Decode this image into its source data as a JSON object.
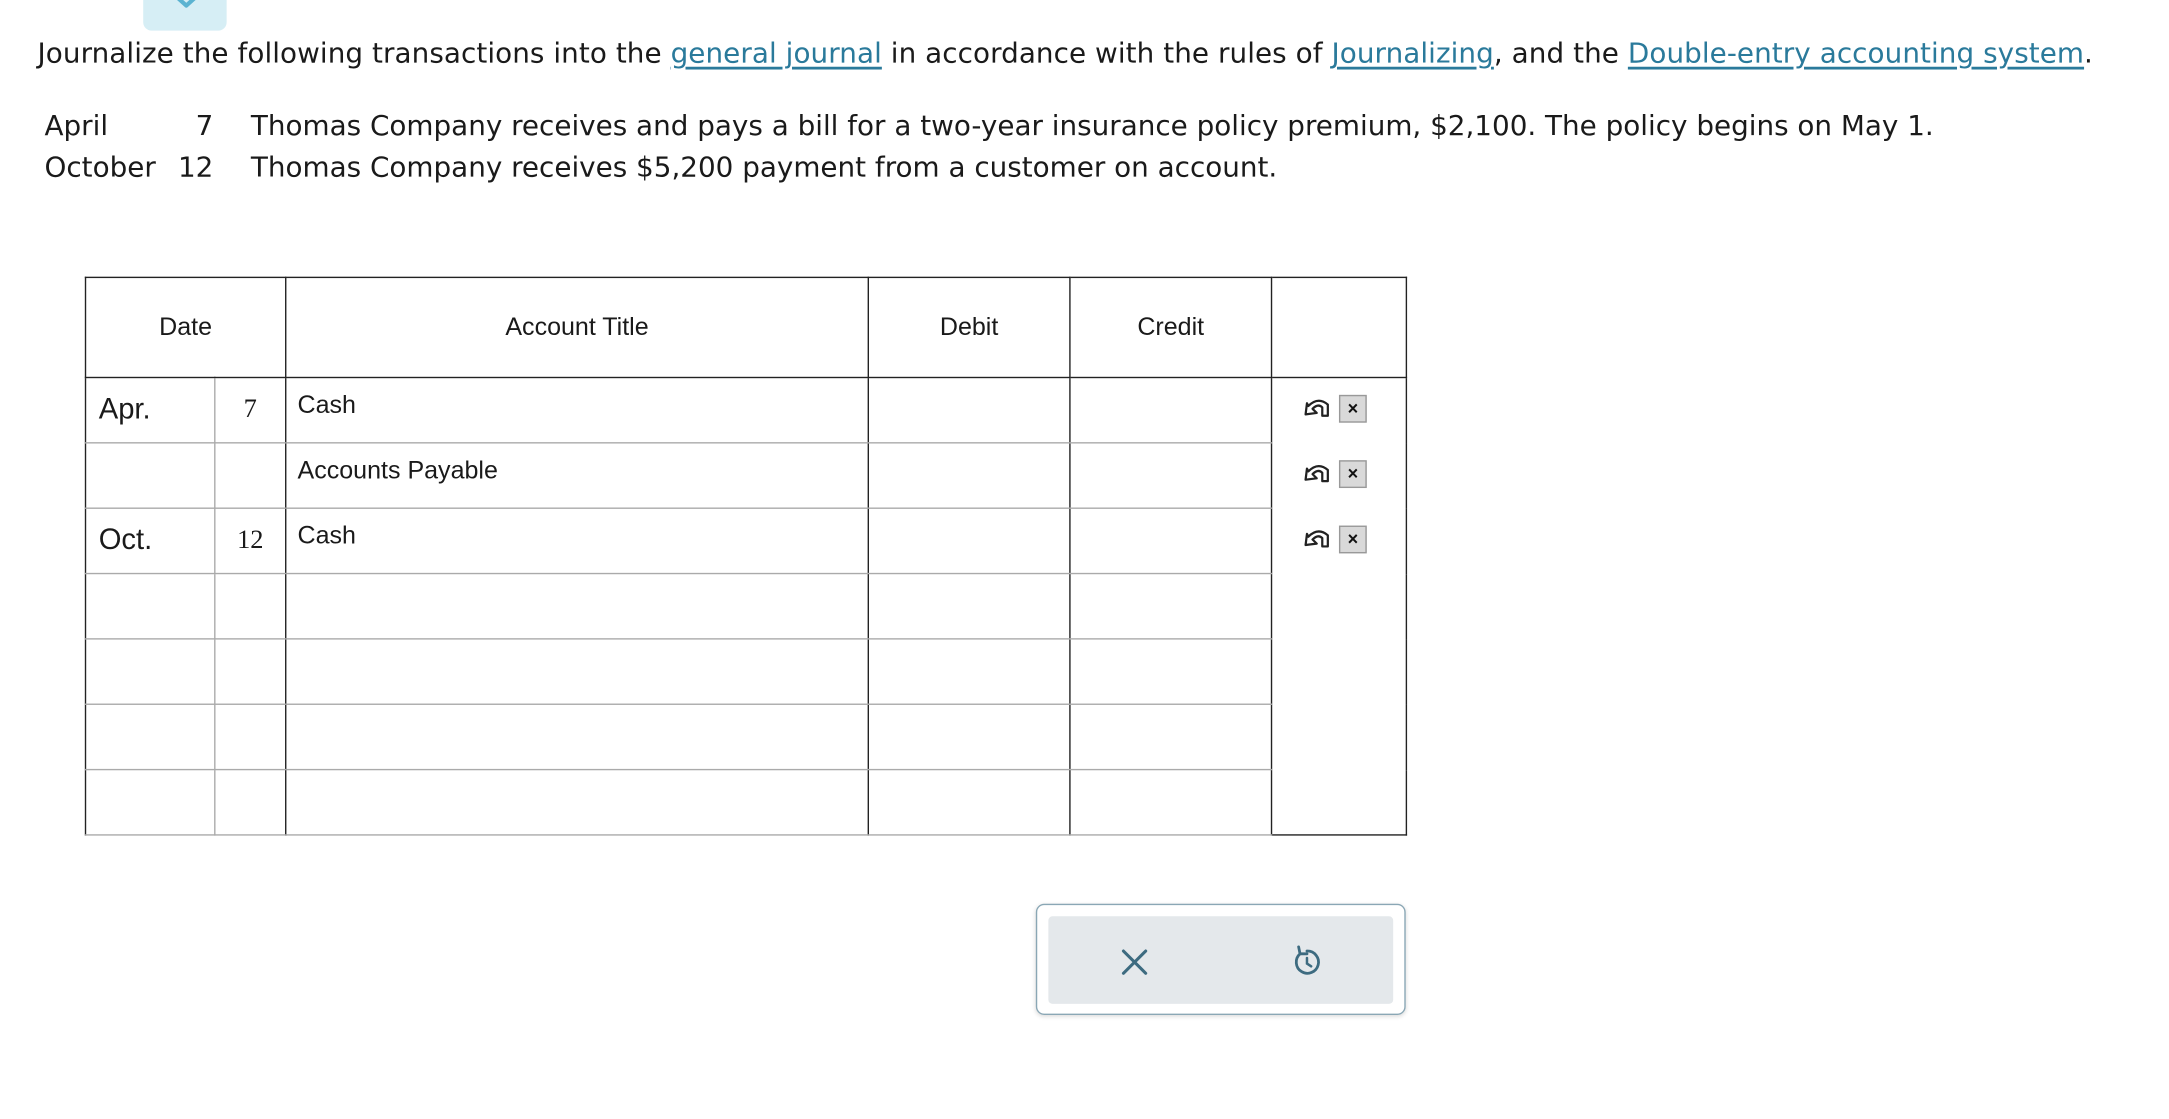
{
  "instruction": {
    "text_1": "Journalize the following transactions into the ",
    "link_1": "general journal",
    "text_2": " in accordance with the rules of ",
    "link_2": "Journalizing",
    "text_3": ", and the ",
    "link_3": "Double-entry accounting system",
    "text_4": "."
  },
  "transactions": [
    {
      "month": "April",
      "day": "7",
      "description": "Thomas Company receives and pays a bill for a two-year insurance policy premium, $2,100. The policy begins on May 1."
    },
    {
      "month": "October",
      "day": "12",
      "description": "Thomas Company receives $5,200 payment from a customer on account."
    }
  ],
  "journal": {
    "headers": {
      "date": "Date",
      "account": "Account Title",
      "debit": "Debit",
      "credit": "Credit"
    },
    "rows": [
      {
        "month": "Apr.",
        "day": "7",
        "account": "Cash",
        "debit": "",
        "credit": ""
      },
      {
        "month": "",
        "day": "",
        "account": "Accounts Payable",
        "debit": "",
        "credit": ""
      },
      {
        "month": "Oct.",
        "day": "12",
        "account": "Cash",
        "debit": "",
        "credit": ""
      },
      {
        "month": "",
        "day": "",
        "account": "",
        "debit": "",
        "credit": ""
      },
      {
        "month": "",
        "day": "",
        "account": "",
        "debit": "",
        "credit": ""
      },
      {
        "month": "",
        "day": "",
        "account": "",
        "debit": "",
        "credit": ""
      },
      {
        "month": "",
        "day": "",
        "account": "",
        "debit": "",
        "credit": ""
      }
    ]
  },
  "icons": {
    "row_undo": "undo-arrow-icon",
    "row_delete": "delete-x-icon",
    "clear": "close-icon",
    "reset": "reset-icon",
    "top_tab": "chevron-down-icon"
  },
  "colors": {
    "link": "#2a7a9b",
    "tab": "#d6eef5",
    "controls_bg": "#e4e8eb",
    "controls_border": "#8aa7b5"
  }
}
